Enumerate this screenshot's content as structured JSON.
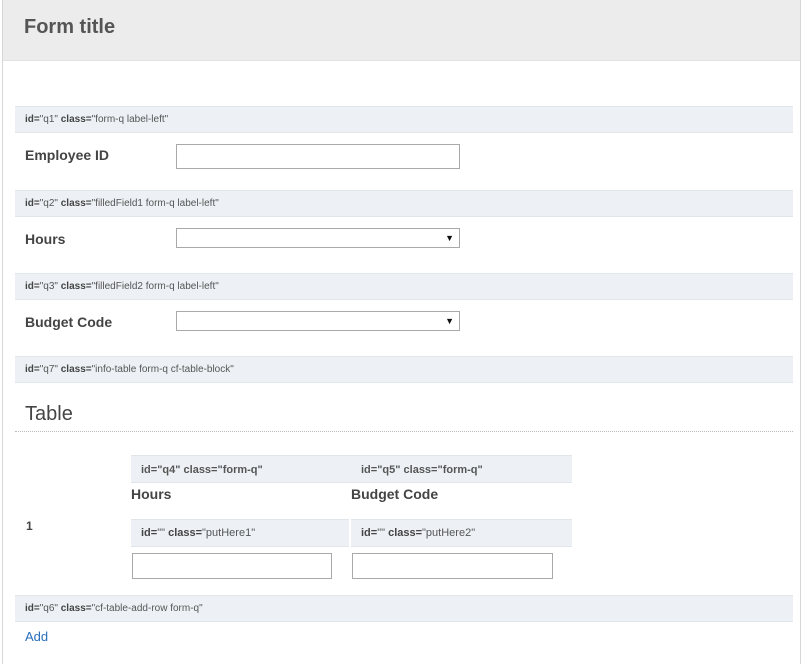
{
  "form": {
    "title": "Form title"
  },
  "questions": {
    "q1": {
      "id_label": "id=",
      "id_value": "\"q1\"",
      "class_label": "class=",
      "class_value": "\"form-q label-left\"",
      "label": "Employee ID",
      "value": ""
    },
    "q2": {
      "id_label": "id=",
      "id_value": "\"q2\"",
      "class_label": "class=",
      "class_value": "\"filledField1 form-q label-left\"",
      "label": "Hours",
      "selected": "",
      "arrow": "▼"
    },
    "q3": {
      "id_label": "id=",
      "id_value": "\"q3\"",
      "class_label": "class=",
      "class_value": "\"filledField2 form-q label-left\"",
      "label": "Budget Code",
      "selected": "",
      "arrow": "▼"
    },
    "q7": {
      "id_label": "id=",
      "id_value": "\"q7\"",
      "class_label": "class=",
      "class_value": "\"info-table form-q cf-table-block\""
    }
  },
  "table": {
    "title": "Table",
    "columns": [
      {
        "id_text": "id=\"q4\" class=\"form-q\"",
        "label": "Hours"
      },
      {
        "id_text": "id=\"q5\" class=\"form-q\"",
        "label": "Budget Code"
      }
    ],
    "rows": [
      {
        "number": "1",
        "cells": [
          {
            "id_label": "id=",
            "id_value": "\"\"",
            "class_label": "class=",
            "class_value": "\"putHere1\"",
            "value": ""
          },
          {
            "id_label": "id=",
            "id_value": "\"\"",
            "class_label": "class=",
            "class_value": "\"putHere2\"",
            "value": ""
          }
        ]
      }
    ]
  },
  "add_row": {
    "id_label": "id=",
    "id_value": "\"q6\"",
    "class_label": "class=",
    "class_value": "\"cf-table-add-row form-q\"",
    "link_label": "Add"
  }
}
